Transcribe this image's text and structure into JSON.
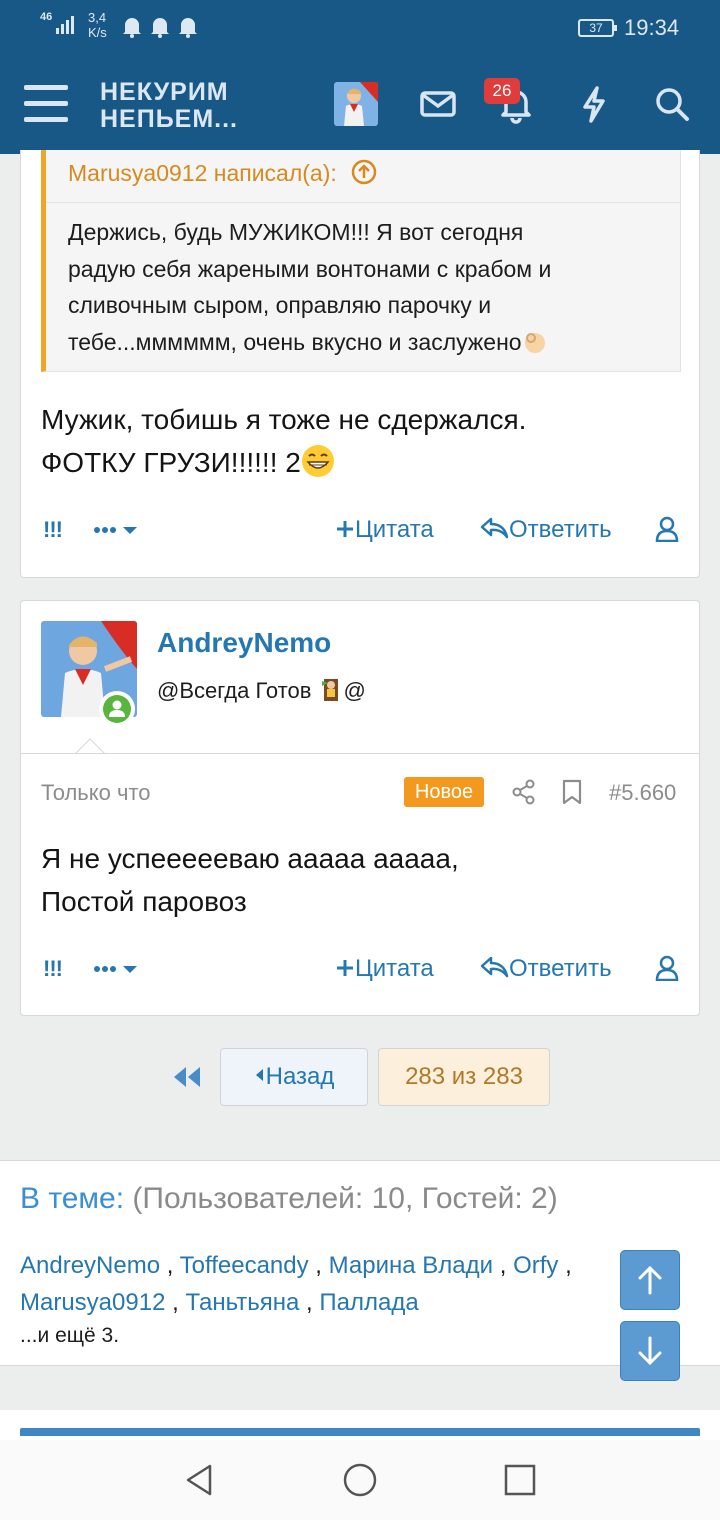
{
  "status_bar": {
    "network": "46",
    "speed_top": "3,4",
    "speed_bottom": "K/s",
    "battery": "37",
    "time": "19:34"
  },
  "header": {
    "logo_line1": "НЕКУРИМ",
    "logo_line2": "НЕПЬЕМ...",
    "notifications_count": "26",
    "icons": [
      "menu-icon",
      "mail-icon",
      "bell-icon",
      "bolt-icon",
      "search-icon"
    ]
  },
  "post1": {
    "quote_author": "Marusya0912 написал(а):",
    "quote_lines": [
      "Держись, будь МУЖИКОМ!!! Я вот сегодня",
      "радую себя жареными вонтонами с крабом и",
      "сливочным сыром, оправляю парочку и",
      "тебе...мммммм, очень вкусно и заслужено"
    ],
    "text_line1": "Мужик, тобишь я тоже не сдержался.",
    "text_line2": "ФОТКУ ГРУЗИ!!!!!! 2"
  },
  "post2": {
    "username": "AndreyNemo",
    "user_title_left": "@Всегда Готов ",
    "user_title_right": "@",
    "time": "Только что",
    "new_label": "Новое",
    "post_number": "#5.660",
    "text_line1": "Я не успеееееваю ааааа ааааа,",
    "text_line2": "Постой паровоз"
  },
  "actions": {
    "bang": "!!!",
    "quote": "Цитата",
    "reply": "Ответить"
  },
  "pagination": {
    "back": "Назад",
    "current": "283 из 283"
  },
  "in_thread": {
    "label": "В теме:",
    "counts": "(Пользователей: 10, Гостей: 2)",
    "users": [
      "AndreyNemo",
      "Toffeecandy",
      "Марина Влади",
      "Orfy",
      "Marusya0912",
      "Таньтьяна",
      "Паллада"
    ],
    "separator": " , ",
    "more": "...и ещё 3."
  },
  "colors": {
    "header_bg": "#185886",
    "link": "#2577b1",
    "quote_accent": "#f0a42c",
    "new_badge": "#f39a1e",
    "notif_badge": "#e03c3c"
  }
}
